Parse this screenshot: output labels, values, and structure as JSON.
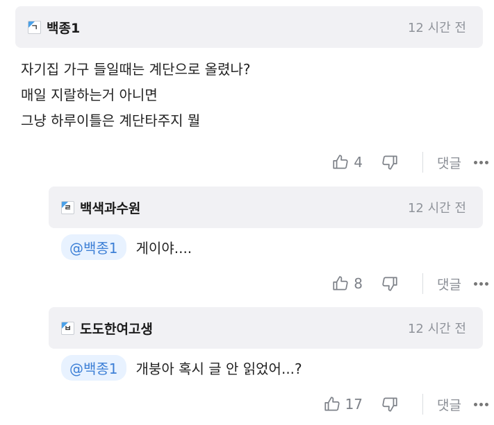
{
  "comments": [
    {
      "level": "ㄱ",
      "author": "백종1",
      "time": "12 시간 전",
      "lines": [
        "자기집 가구 들일때는 계단으로 올렸나?",
        "매일 지랄하는거 아니면",
        "그냥 하루이틀은 계단타주지 뭘"
      ],
      "likes": "4",
      "reply_label": "댓글"
    },
    {
      "level": "ㄹ",
      "author": "백색과수원",
      "time": "12 시간 전",
      "mention": "@백종1",
      "text": "게이야....",
      "likes": "8",
      "reply_label": "댓글"
    },
    {
      "level": "ㅂ",
      "author": "도도한여고생",
      "time": "12 시간 전",
      "mention": "@백종1",
      "text": "개붕아 혹시 글 안 읽었어...?",
      "likes": "17",
      "reply_label": "댓글"
    }
  ],
  "icons": {
    "like": "thumbs-up-icon",
    "dislike": "thumbs-down-icon",
    "more": "more-icon"
  }
}
